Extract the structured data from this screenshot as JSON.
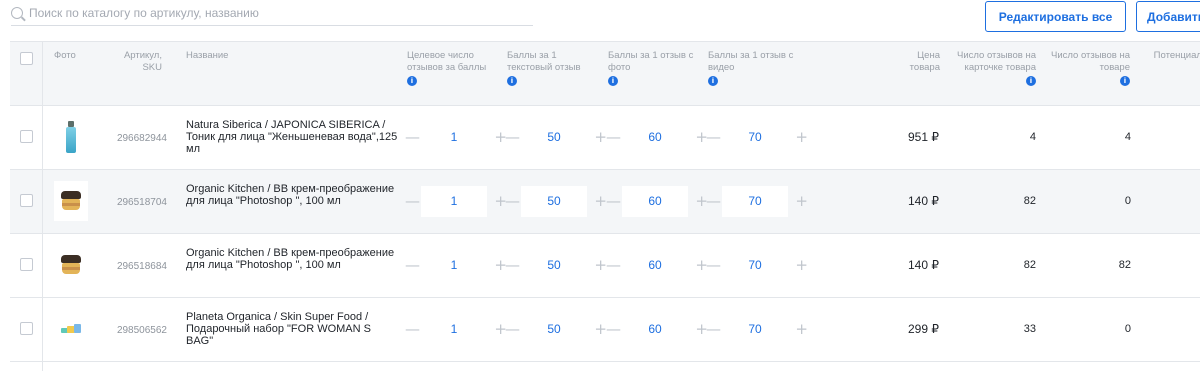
{
  "search": {
    "placeholder": "Поиск по каталогу по артикулу, названию"
  },
  "toolbar": {
    "edit_all": "Редактировать все",
    "add": "Добавить"
  },
  "table": {
    "headers": {
      "photo": "Фото",
      "sku": "Артикул, SKU",
      "name": "Название",
      "target": "Целевое число отзывов за баллы",
      "text_points": "Баллы за 1 текстовый отзыв",
      "photo_points": "Баллы за 1 отзыв с фото",
      "video_points": "Баллы за 1 отзыв с видео",
      "price": "Цена товара",
      "reviews_card": "Число отзывов на карточке товара",
      "reviews_product": "Число отзывов на товаре",
      "potential": "Потенциал от"
    },
    "rows": [
      {
        "image": "bottle",
        "sku": "296682944",
        "name": "Natura Siberica / JAPONICA SIBERICA / Тоник для лица \"Женьшеневая вода\",125 мл",
        "target": "1",
        "text_points": "50",
        "photo_points": "60",
        "video_points": "70",
        "price": "951 ₽",
        "reviews_card": "4",
        "reviews_product": "4"
      },
      {
        "image": "jar",
        "sku": "296518704",
        "name": "Organic Kitchen / BB крем-преображение для лица \"Photoshop \", 100 мл",
        "target": "1",
        "text_points": "50",
        "photo_points": "60",
        "video_points": "70",
        "price": "140 ₽",
        "reviews_card": "82",
        "reviews_product": "0"
      },
      {
        "image": "jar",
        "sku": "296518684",
        "name": "Organic Kitchen / BB крем-преображение для лица \"Photoshop \", 100 мл",
        "target": "1",
        "text_points": "50",
        "photo_points": "60",
        "video_points": "70",
        "price": "140 ₽",
        "reviews_card": "82",
        "reviews_product": "82"
      },
      {
        "image": "gift-set",
        "sku": "298506562",
        "name": "Planeta Organica / Skin Super Food / Подарочный набор \"FOR WOMAN S BAG\"",
        "target": "1",
        "text_points": "50",
        "photo_points": "60",
        "video_points": "70",
        "price": "299 ₽",
        "reviews_card": "33",
        "reviews_product": "0"
      }
    ]
  },
  "icons": {
    "search": "search-icon",
    "info": "info-icon",
    "stepper_minus": "minus-icon",
    "stepper_plus": "plus-icon"
  },
  "colors": {
    "accent": "#1e6fe0",
    "header_bg": "#f4f6f8",
    "muted_text": "#9aa0a8"
  }
}
